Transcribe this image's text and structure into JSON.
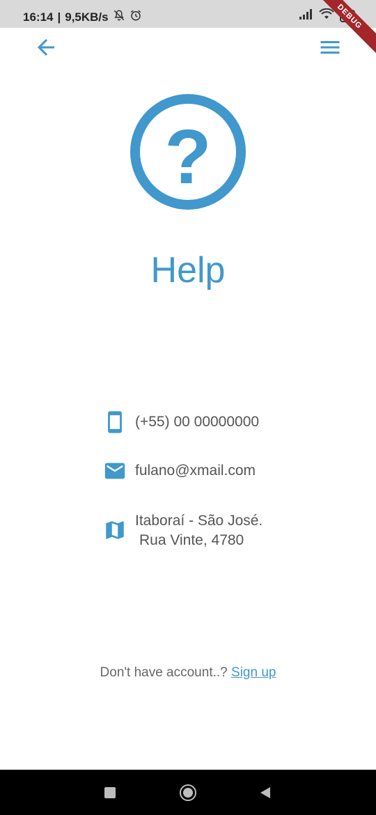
{
  "status_bar": {
    "time": "16:14",
    "speed": "9,5KB/s",
    "battery": "73",
    "debug_label": "DEBUG"
  },
  "appbar": {
    "back_icon": "arrow-back-icon",
    "menu_icon": "hamburger-menu-icon"
  },
  "page": {
    "icon": "help-circle-icon",
    "title": "Help"
  },
  "contacts": {
    "phone": "(+55) 00 00000000",
    "email": "fulano@xmail.com",
    "address_line1": "Itaboraí - São José.",
    "address_line2": "Rua Vinte, 4780"
  },
  "signup": {
    "prompt": "Don't have account..? ",
    "link": "Sign up"
  },
  "colors": {
    "accent": "#4098cd",
    "text": "#555555",
    "status_bar": "#d9d9d9",
    "nav_bar": "#000000"
  }
}
